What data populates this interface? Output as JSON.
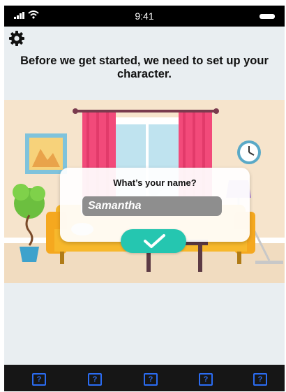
{
  "status_bar": {
    "time": "9:41"
  },
  "icons": {
    "settings": "gear-icon",
    "confirm": "checkmark-icon",
    "tabs": "question-mark-icon"
  },
  "intro": {
    "text": "Before we get started, we need to set up your character."
  },
  "dialog": {
    "question": "What’s your name?",
    "name_value": "Samantha"
  },
  "tab_bar": {
    "items": [
      "?",
      "?",
      "?",
      "?",
      "?"
    ]
  },
  "colors": {
    "accent": "#25c6b0",
    "tab_icon": "#2b6cf2",
    "curtain": "#f24a7a",
    "sofa": "#f7b82c"
  }
}
